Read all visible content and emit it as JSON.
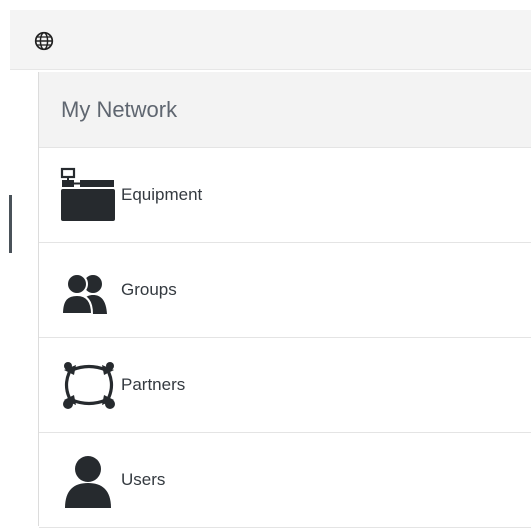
{
  "panel": {
    "title": "My Network"
  },
  "menu": {
    "items": [
      {
        "label": "Equipment",
        "icon": "equipment-icon"
      },
      {
        "label": "Groups",
        "icon": "groups-icon"
      },
      {
        "label": "Partners",
        "icon": "partners-icon"
      },
      {
        "label": "Users",
        "icon": "users-icon"
      }
    ]
  },
  "colors": {
    "icon": "#262a2e",
    "text": "#343a40",
    "header_bg": "#f3f3f3",
    "divider": "#e4e4e4",
    "side_indicator": "#4a5259"
  }
}
